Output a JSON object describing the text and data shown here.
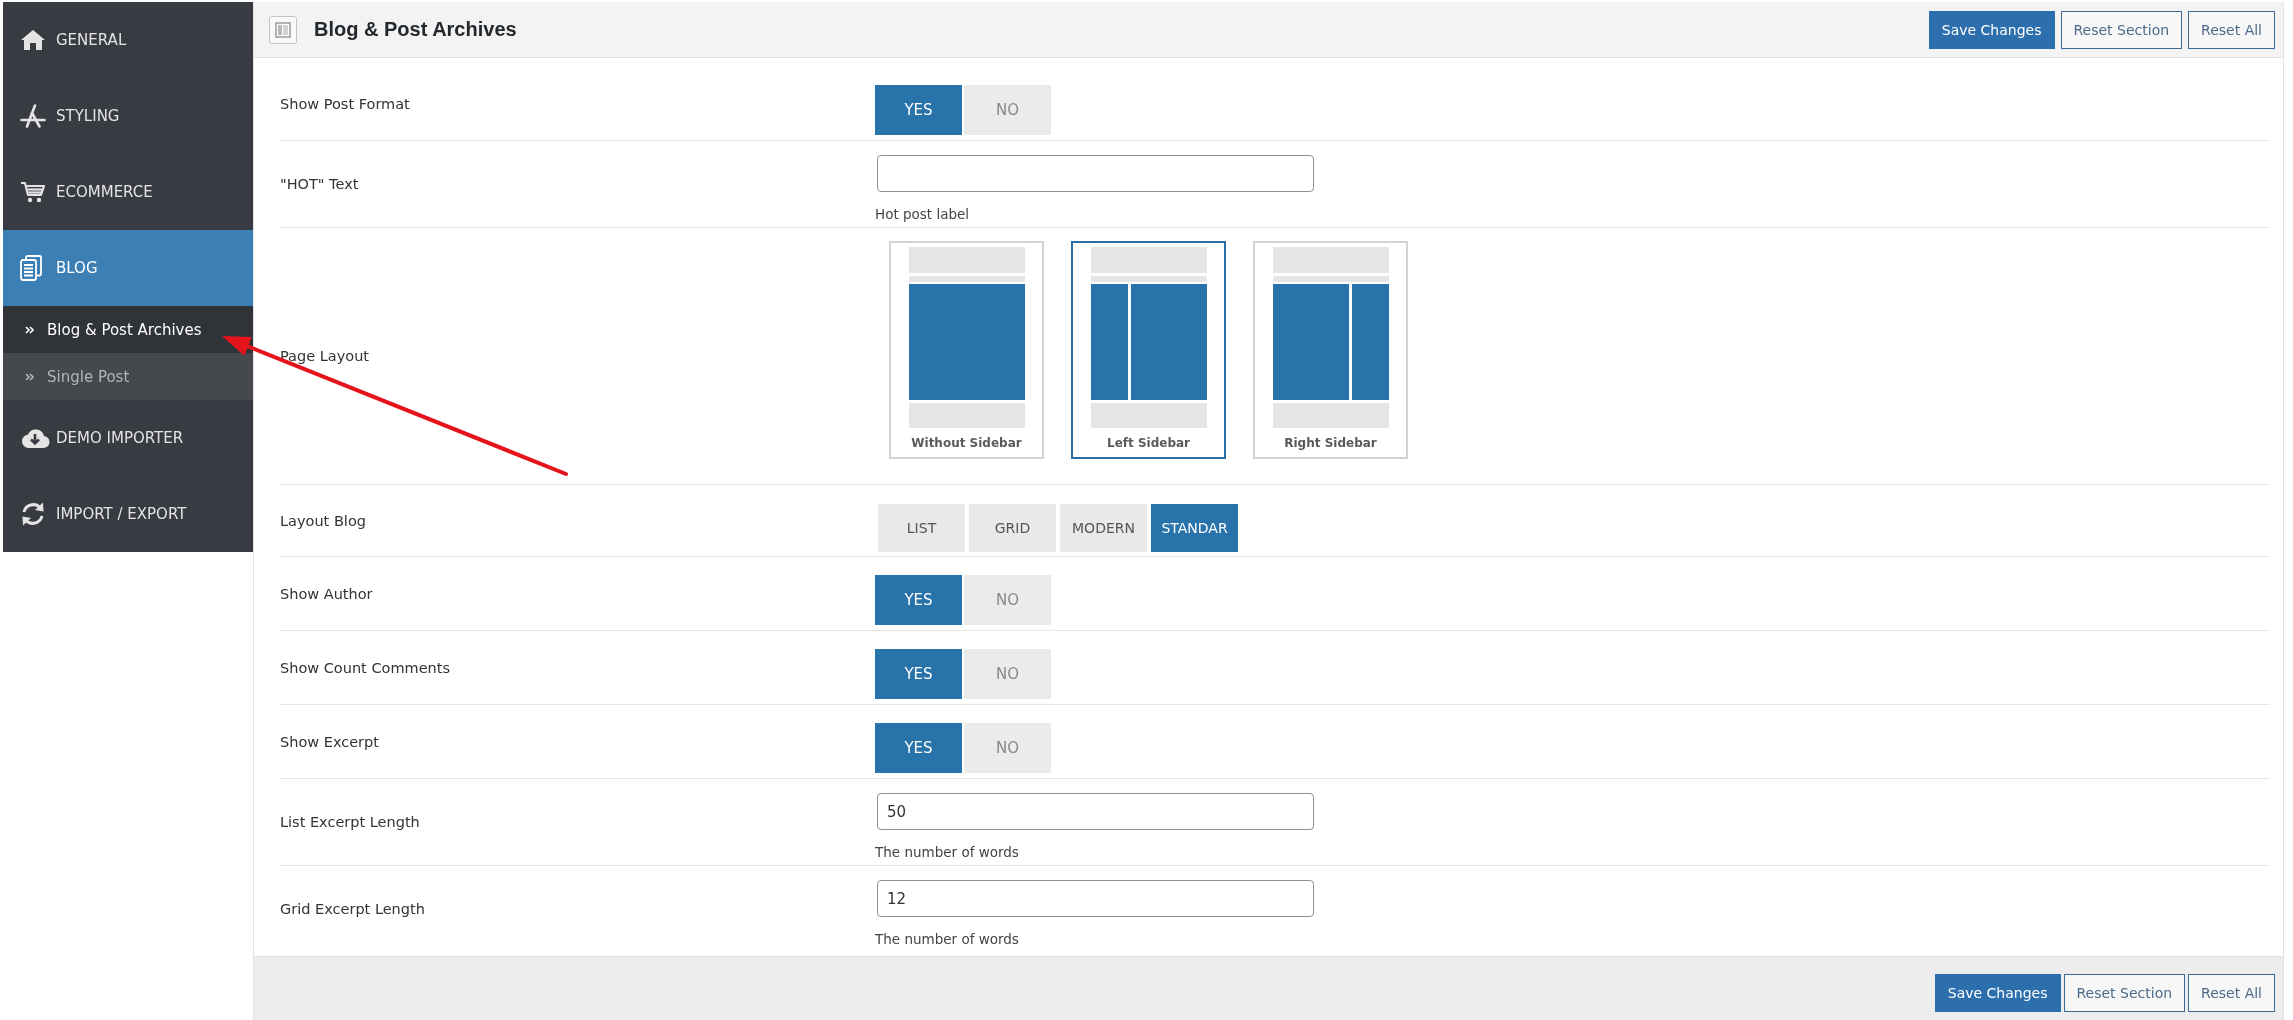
{
  "sidebar": {
    "items": [
      {
        "label": "GENERAL",
        "selected": false
      },
      {
        "label": "STYLING",
        "selected": false
      },
      {
        "label": "ECOMMERCE",
        "selected": false
      },
      {
        "label": "BLOG",
        "selected": true,
        "children": [
          {
            "label": "Blog & Post Archives",
            "selected": true
          },
          {
            "label": "Single Post",
            "selected": false
          }
        ]
      },
      {
        "label": "DEMO IMPORTER",
        "selected": false
      },
      {
        "label": "IMPORT / EXPORT",
        "selected": false
      }
    ]
  },
  "header": {
    "title": "Blog & Post Archives",
    "buttons": [
      {
        "label": "Save Changes",
        "kind": "primary"
      },
      {
        "label": "Reset Section",
        "kind": "secondary"
      },
      {
        "label": "Reset All",
        "kind": "secondary"
      }
    ]
  },
  "fields": [
    {
      "kind": "toggle",
      "label": "Show Post Format",
      "options": [
        {
          "label": "YES",
          "selected": true
        },
        {
          "label": "NO",
          "selected": false
        }
      ]
    },
    {
      "kind": "text",
      "label": "\"HOT\" Text",
      "description": "Hot post label"
    },
    {
      "kind": "images",
      "label": "Page Layout",
      "options": [
        {
          "label": "Without Sidebar",
          "kind": "full",
          "selected": false
        },
        {
          "label": "Left Sidebar",
          "kind": "left",
          "selected": true
        },
        {
          "label": "Right Sidebar",
          "kind": "right",
          "selected": false
        }
      ]
    },
    {
      "kind": "buttonset",
      "label": "Layout Blog",
      "options": [
        {
          "label": "LIST",
          "selected": false
        },
        {
          "label": "GRID",
          "selected": false
        },
        {
          "label": "MODERN",
          "selected": false
        },
        {
          "label": "STANDAR",
          "selected": true
        }
      ]
    },
    {
      "kind": "toggle",
      "label": "Show Author",
      "options": [
        {
          "label": "YES",
          "selected": true
        },
        {
          "label": "NO",
          "selected": false
        }
      ]
    },
    {
      "kind": "toggle",
      "label": "Show Count Comments",
      "options": [
        {
          "label": "YES",
          "selected": true
        },
        {
          "label": "NO",
          "selected": false
        }
      ]
    },
    {
      "kind": "toggle",
      "label": "Show Excerpt",
      "options": [
        {
          "label": "YES",
          "selected": true
        },
        {
          "label": "NO",
          "selected": false
        }
      ]
    },
    {
      "kind": "text",
      "label": "List Excerpt Length",
      "value": "50",
      "description": "The number of words"
    },
    {
      "kind": "text",
      "label": "Grid Excerpt Length",
      "value": "12",
      "description": "The number of words"
    }
  ],
  "footer": {
    "buttons": [
      {
        "label": "Save Changes",
        "kind": "primary"
      },
      {
        "label": "Reset Section",
        "kind": "secondary"
      },
      {
        "label": "Reset All",
        "kind": "secondary"
      }
    ]
  }
}
